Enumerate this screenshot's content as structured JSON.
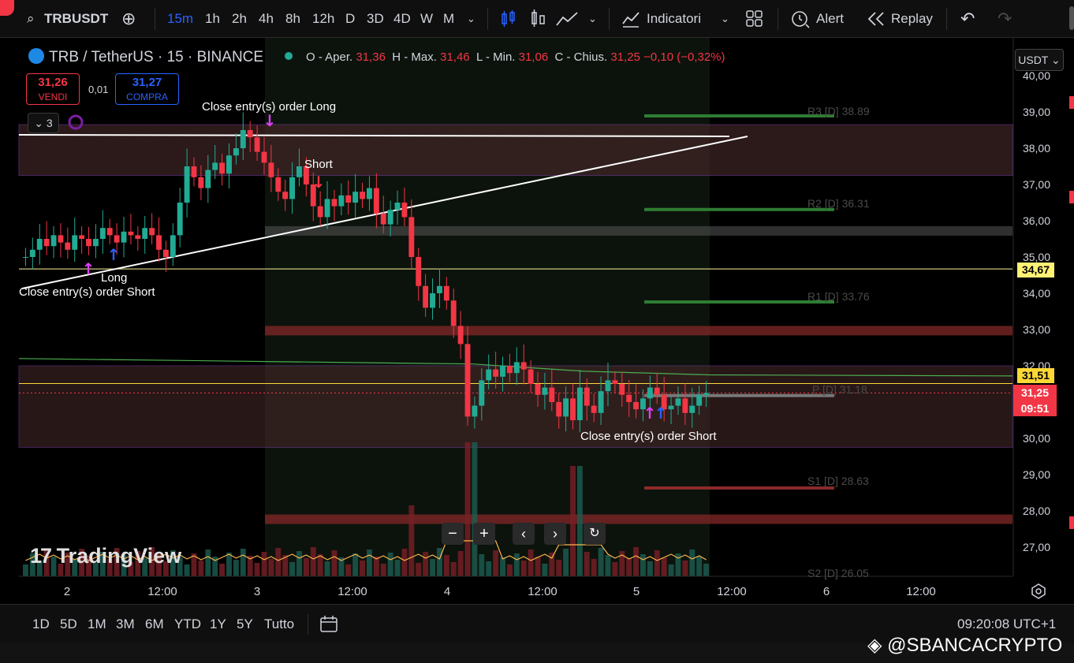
{
  "toolbar": {
    "symbol": "TRBUSDT",
    "intervals": [
      "15m",
      "1h",
      "2h",
      "4h",
      "8h",
      "12h",
      "D",
      "3D",
      "4D",
      "W",
      "M"
    ],
    "active_interval": "15m",
    "indicators_label": "Indicatori",
    "alert_label": "Alert",
    "replay_label": "Replay"
  },
  "header": {
    "title": "TRB / TetherUS · 15 · BINANCE",
    "ohlc": {
      "o_label": "O - Aper.",
      "o": "31,36",
      "h_label": "H - Max.",
      "h": "31,46",
      "l_label": "L - Min.",
      "l": "31,06",
      "c_label": "C - Chius.",
      "c": "31,25",
      "change": "−0,10 (−0,32%)"
    },
    "sell_price": "31,26",
    "sell_label": "VENDI",
    "spread": "0,01",
    "buy_price": "31,27",
    "buy_label": "COMPRA",
    "indicator_count": "3"
  },
  "currency_button": "USDT",
  "price_labels": {
    "level_line": "34,67",
    "yellow_line": "31,51",
    "last_price": "31,25",
    "countdown": "09:51"
  },
  "annotations": {
    "close_long": "Close entry(s) order Long",
    "short": "Short",
    "long": "Long",
    "close_short_left": "Close entry(s) order Short",
    "close_short_right": "Close entry(s) order Short"
  },
  "pivots": {
    "r3": "R3 [D] 38.89",
    "r2": "R2 [D] 36.31",
    "r1": "R1 [D] 33.76",
    "p": "P [D] 31.18",
    "s1": "S1 [D] 28.63",
    "s2": "S2 [D] 26.05"
  },
  "watermark": "TradingView",
  "bottom": {
    "ranges": [
      "1D",
      "5D",
      "1M",
      "3M",
      "6M",
      "YTD",
      "1Y",
      "5Y",
      "Tutto"
    ],
    "time": "09:20:08 UTC+1"
  },
  "credit": "@SBANCACRYPTO",
  "chart_data": {
    "type": "candlestick",
    "y_axis_ticks": [
      "40,00",
      "39,00",
      "38,00",
      "37,00",
      "36,00",
      "35,00",
      "34,00",
      "33,00",
      "32,00",
      "30,00",
      "29,00",
      "28,00",
      "27,00"
    ],
    "x_axis_ticks": [
      "2",
      "12:00",
      "3",
      "12:00",
      "4",
      "12:00",
      "5",
      "12:00",
      "6",
      "12:00"
    ],
    "ylim": [
      26,
      40
    ],
    "close_path": [
      35.0,
      35.2,
      35.5,
      35.3,
      35.6,
      35.4,
      35.2,
      35.6,
      35.5,
      35.3,
      35.5,
      35.8,
      35.6,
      35.4,
      35.7,
      35.6,
      35.5,
      35.8,
      35.6,
      35.2,
      35.0,
      35.6,
      36.5,
      37.5,
      37.2,
      36.9,
      37.4,
      37.6,
      37.3,
      37.8,
      38.0,
      38.5,
      38.3,
      37.9,
      37.6,
      37.2,
      36.8,
      36.6,
      37.2,
      37.5,
      37.0,
      36.4,
      36.1,
      36.6,
      36.4,
      36.7,
      36.5,
      36.8,
      36.6,
      36.9,
      36.2,
      35.9,
      36.3,
      36.5,
      36.1,
      35.0,
      34.2,
      33.6,
      34.0,
      34.2,
      33.8,
      33.1,
      32.6,
      30.6,
      30.9,
      31.6,
      31.9,
      31.7,
      32.0,
      31.8,
      32.1,
      31.9,
      31.5,
      31.2,
      31.4,
      31.0,
      30.6,
      31.1,
      30.5,
      31.4,
      30.9,
      30.7,
      31.3,
      31.6,
      31.5,
      31.2,
      31.0,
      30.8,
      31.1,
      31.4,
      31.2,
      30.8,
      30.9,
      31.1,
      30.7,
      30.9,
      31.2,
      31.25
    ]
  }
}
